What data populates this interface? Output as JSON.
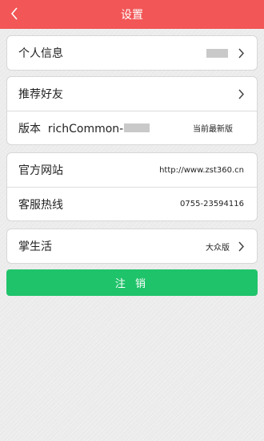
{
  "header": {
    "title": "设置",
    "back_icon": "chevron-left-icon"
  },
  "profile_card": {
    "personal_info_label": "个人信息"
  },
  "app_card": {
    "recommend_label": "推荐好友",
    "version_label": "版本  richCommon-",
    "version_status": "当前最新版"
  },
  "contact_card": {
    "website_label": "官方网站",
    "website_value": "http://www.zst360.cn",
    "hotline_label": "客服热线",
    "hotline_value": "0755-23594116"
  },
  "life_card": {
    "label": "掌生活",
    "value": "大众版"
  },
  "logout_label": "注 销",
  "colors": {
    "header_bg": "#f25656",
    "logout_bg": "#1fc36a",
    "page_bg": "#ececec"
  }
}
